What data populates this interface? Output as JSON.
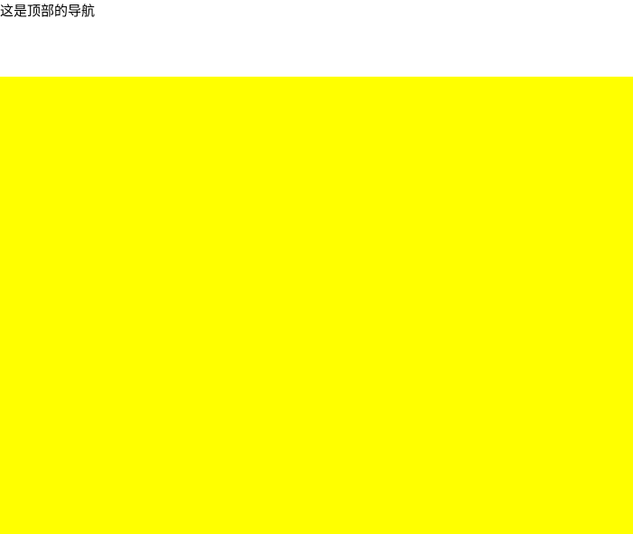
{
  "header": {
    "nav_text": "这是顶部的导航"
  },
  "content": {
    "background_color": "#ffff00"
  }
}
